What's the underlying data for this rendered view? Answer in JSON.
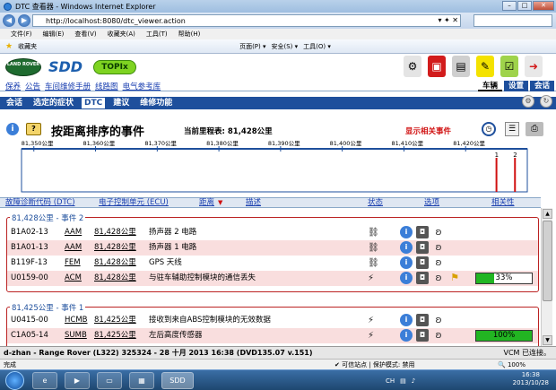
{
  "browser": {
    "title": "DTC 查看器 - Windows Internet Explorer",
    "url": "http://localhost:8080/dtc_viewer.action",
    "search_placeholder": "",
    "menus": [
      "文件(F)",
      "编辑(E)",
      "查看(V)",
      "收藏夹(A)",
      "工具(T)",
      "帮助(H)"
    ],
    "favorites_label": "收藏夹",
    "toolbar": [
      "页面(P) ▾",
      "安全(S) ▾",
      "工具(O) ▾"
    ],
    "status_left": "完成",
    "status_mid": "可信站点 | 保护模式: 禁用",
    "zoom": "100%"
  },
  "sdd": {
    "brand_logo": "LAND ROVER",
    "sdd_logo": "SDD",
    "topix_label": "TOPIx",
    "top_links": [
      "保养",
      "公告",
      "车间维修手册",
      "线路图",
      "电气参考库"
    ],
    "right_tabs": [
      {
        "label": "车辆",
        "active": true
      },
      {
        "label": "设置",
        "active": false
      },
      {
        "label": "会话",
        "active": false
      }
    ],
    "sub_tabs": [
      {
        "label": "会话",
        "active": false
      },
      {
        "label": "选定的症状",
        "active": false
      },
      {
        "label": "DTC",
        "active": true
      },
      {
        "label": "建议",
        "active": false
      },
      {
        "label": "维修功能",
        "active": false
      }
    ],
    "event_title": "按距离排序的事件",
    "mileage": "当前里程表: 81,428公里",
    "show_relevant": "显示相关事件",
    "footer": "d-zhan - Range Rover (L322) 325324 - 28 十月 2013 16:38 (DVD135.07 v.151)",
    "vcm_status": "VCM 已连接。"
  },
  "timeline": {
    "ticks": [
      "81,350公里",
      "81,360公里",
      "81,370公里",
      "81,380公里",
      "81,390公里",
      "81,400公里",
      "81,410公里",
      "81,420公里"
    ],
    "tick_values": [
      81350,
      81360,
      81370,
      81380,
      81390,
      81400,
      81410,
      81420
    ],
    "range": [
      81348,
      81430
    ],
    "markers": [
      {
        "km": 81425,
        "count": "1"
      },
      {
        "km": 81428,
        "count": "2"
      }
    ]
  },
  "columns": [
    "故障诊断代码 (DTC)",
    "电子控制单元 (ECU)",
    "距离",
    "描述",
    "状态",
    "选项",
    "相关性"
  ],
  "groups": [
    {
      "label": "81,428公里 - 事件 2",
      "rows": [
        {
          "code": "B1A02-13",
          "ecu": "AAM",
          "dist": "81,428公里",
          "desc": "扬声器 2 电路",
          "relevance": null,
          "pink": false
        },
        {
          "code": "B1A01-13",
          "ecu": "AAM",
          "dist": "81,428公里",
          "desc": "扬声器 1 电路",
          "relevance": null,
          "pink": true
        },
        {
          "code": "B119F-13",
          "ecu": "FEM",
          "dist": "81,428公里",
          "desc": "GPS 天线",
          "relevance": null,
          "pink": false
        },
        {
          "code": "U0159-00",
          "ecu": "ACM",
          "dist": "81,428公里",
          "desc": "与驻车辅助控制模块的通信丢失",
          "relevance": "33%",
          "relevance_value": 33,
          "pink": true
        }
      ]
    },
    {
      "label": "81,425公里 - 事件 1",
      "rows": [
        {
          "code": "U0415-00",
          "ecu": "HCMB",
          "dist": "81,425公里",
          "desc": "接收到来自ABS控制模块的无效数据",
          "relevance": null,
          "pink": false
        },
        {
          "code": "C1A05-14",
          "ecu": "SUMB",
          "dist": "81,425公里",
          "desc": "左后高度传感器",
          "relevance": "100%",
          "relevance_value": 100,
          "pink": true
        }
      ]
    }
  ],
  "taskbar": {
    "clock_time": "16:38",
    "clock_date": "2013/10/28",
    "tray_lang": "CH"
  }
}
